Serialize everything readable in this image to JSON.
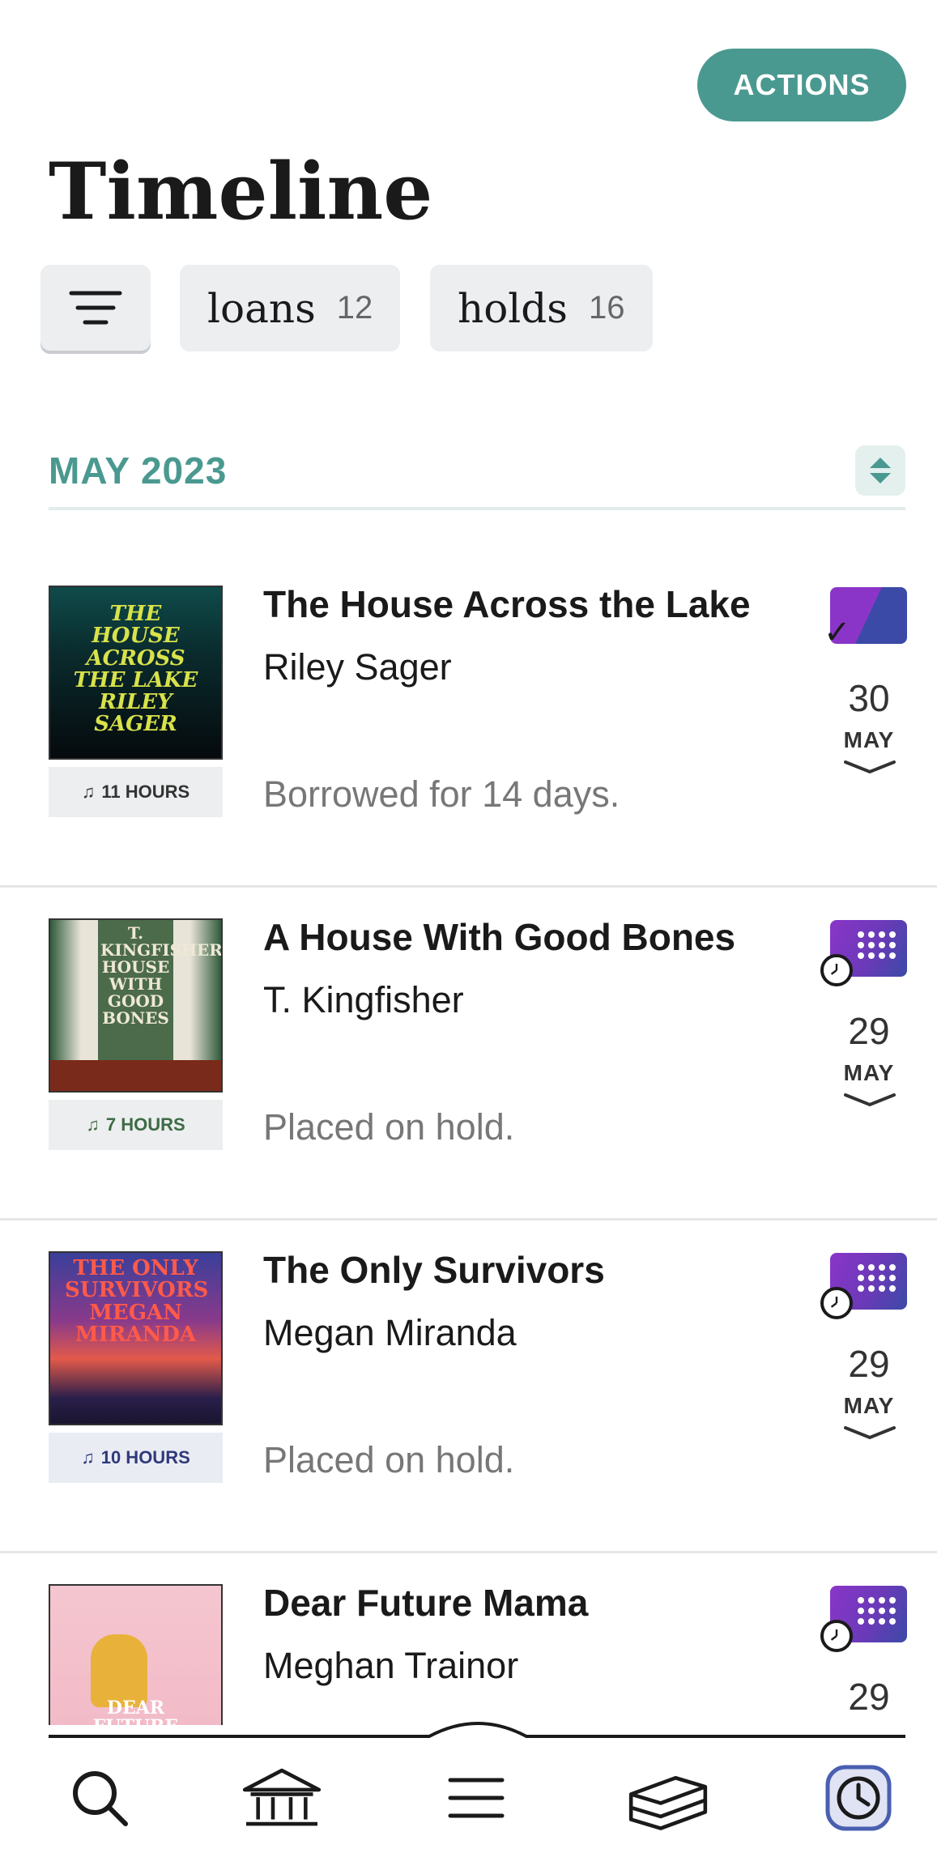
{
  "header": {
    "actions_label": "ACTIONS",
    "title": "Timeline"
  },
  "filters": {
    "loans_label": "loans",
    "loans_count": "12",
    "holds_label": "holds",
    "holds_count": "16"
  },
  "section": {
    "title": "MAY 2023"
  },
  "items": [
    {
      "title": "The House Across the Lake",
      "author": "Riley Sager",
      "status": "Borrowed for 14 days.",
      "duration": "11 HOURS",
      "day": "30",
      "month": "MAY",
      "cover_text": "THE HOUSE ACROSS THE LAKE RILEY SAGER",
      "badge": "borrowed-check-icon"
    },
    {
      "title": "A House With Good Bones",
      "author": "T. Kingfisher",
      "status": "Placed on hold.",
      "duration": "7 HOURS",
      "day": "29",
      "month": "MAY",
      "cover_text": "T. KINGFISHER HOUSE WITH GOOD BONES",
      "badge": "hold-clock-icon"
    },
    {
      "title": "The Only Survivors",
      "author": "Megan Miranda",
      "status": "Placed on hold.",
      "duration": "10 HOURS",
      "day": "29",
      "month": "MAY",
      "cover_text": "THE ONLY SURVIVORS MEGAN MIRANDA",
      "badge": "hold-clock-icon"
    },
    {
      "title": "Dear Future Mama",
      "author": "Meghan Trainor",
      "status": "",
      "duration": "",
      "day": "29",
      "month": "",
      "cover_text": "DEAR FUTURE MAMA",
      "badge": "hold-clock-icon"
    }
  ],
  "nav": [
    "search-icon",
    "library-icon",
    "menu-icon",
    "books-icon",
    "timeline-clock-icon"
  ],
  "colors": {
    "accent": "#4a9990",
    "badge_purple": "#8a35c8",
    "badge_blue": "#3b4aa6",
    "nav_active": "#4a5fb0"
  }
}
